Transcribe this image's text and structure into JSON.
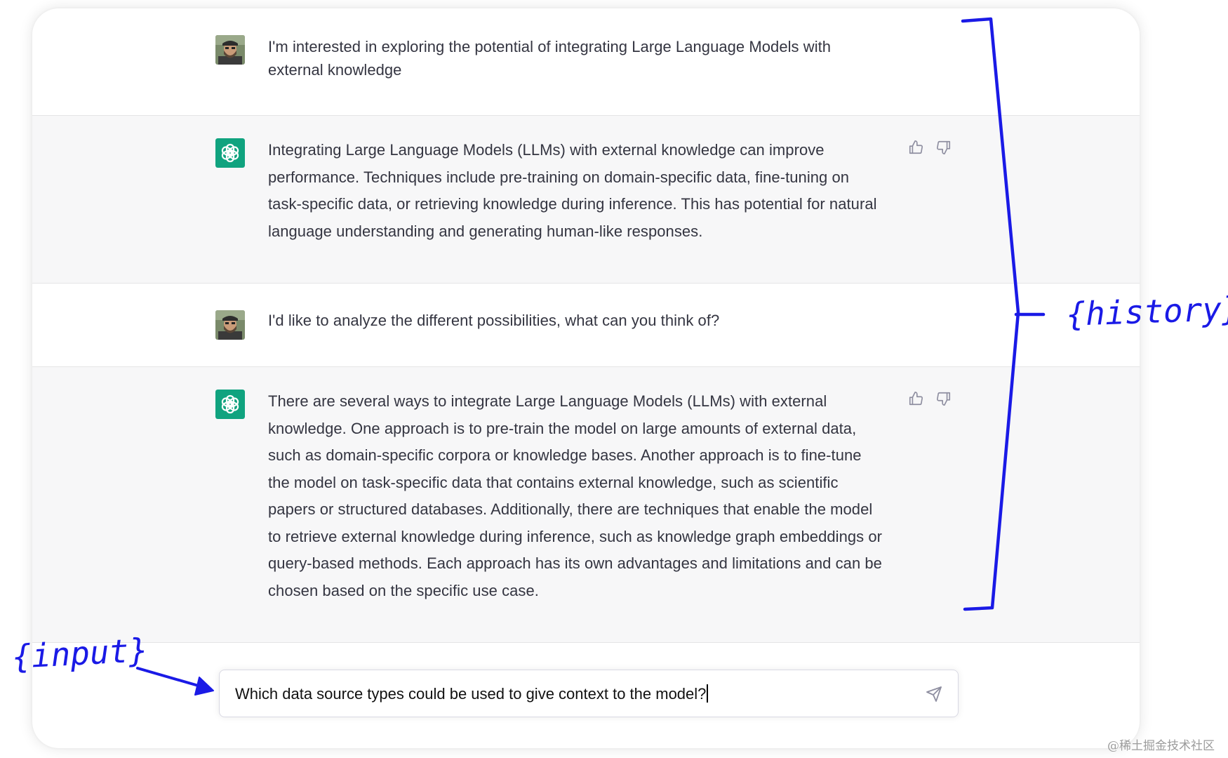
{
  "conversation": [
    {
      "role": "user",
      "avatar_icon": "user-avatar-photo",
      "text": "I'm interested in exploring the potential of integrating Large Language Models with\nexternal knowledge"
    },
    {
      "role": "assistant",
      "avatar_icon": "openai-logo",
      "text": "Integrating Large Language Models (LLMs) with external knowledge can improve\nperformance. Techniques include pre-training on domain-specific data, fine-tuning on\ntask-specific data, or retrieving knowledge during inference. This has potential for natural\nlanguage understanding and generating human-like responses."
    },
    {
      "role": "user",
      "avatar_icon": "user-avatar-photo",
      "text": "I'd like to analyze the different possibilities, what can you think of?"
    },
    {
      "role": "assistant",
      "avatar_icon": "openai-logo",
      "text": "There are several ways to integrate Large Language Models (LLMs) with external\nknowledge. One approach is to pre-train the model on large amounts of external data,\nsuch as domain-specific corpora or knowledge bases. Another approach is to fine-tune\nthe model on task-specific data that contains external knowledge, such as scientific\npapers or structured databases. Additionally, there are techniques that enable the model\nto retrieve external knowledge during inference, such as knowledge graph embeddings or\nquery-based methods. Each approach has its own advantages and limitations and can be\nchosen based on the specific use case."
    }
  ],
  "input": {
    "value": "Which data source types could be used to give context to the model?"
  },
  "annotations": {
    "history_label": "{history}",
    "input_label": "{input}"
  },
  "watermark": "@稀土掘金技术社区",
  "colors": {
    "assistant_bg": "#f7f7f8",
    "logo_green": "#10a37f",
    "annotation_blue": "#1a1ae6",
    "text": "#343541"
  }
}
